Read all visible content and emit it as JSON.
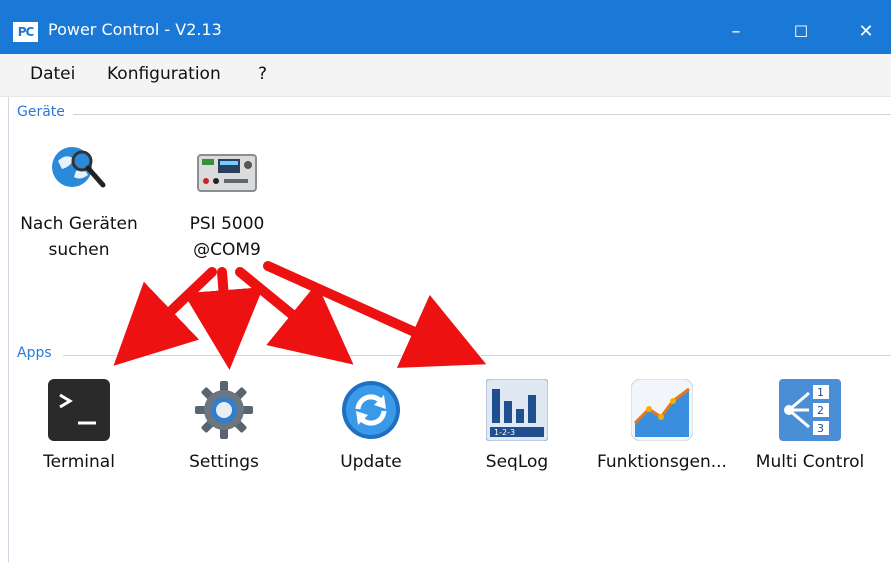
{
  "window": {
    "app_badge": "PC",
    "title": "Power Control - V2.13",
    "minimize_glyph": "–",
    "maximize_glyph": "☐",
    "close_glyph": "✕"
  },
  "menu": {
    "items": [
      "Datei",
      "Konfiguration",
      "?"
    ]
  },
  "sections": {
    "devices": {
      "title": "Geräte",
      "tiles": [
        {
          "label": "Nach Geräten suchen",
          "icon": "globe-search-icon"
        },
        {
          "label": "PSI 5000 @COM9",
          "icon": "power-supply-icon"
        }
      ]
    },
    "apps": {
      "title": "Apps",
      "tiles": [
        {
          "label": "Terminal",
          "icon": "terminal-icon"
        },
        {
          "label": "Settings",
          "icon": "settings-gear-icon"
        },
        {
          "label": "Update",
          "icon": "update-sync-icon"
        },
        {
          "label": "SeqLog",
          "icon": "seqlog-icon"
        },
        {
          "label": "Funktionsgen...",
          "icon": "function-generator-icon"
        },
        {
          "label": "Multi Control",
          "icon": "multi-control-icon"
        }
      ]
    }
  },
  "colors": {
    "titlebar": "#1a78d6",
    "section_text": "#2a7ad8",
    "arrow": "#ee1111"
  }
}
